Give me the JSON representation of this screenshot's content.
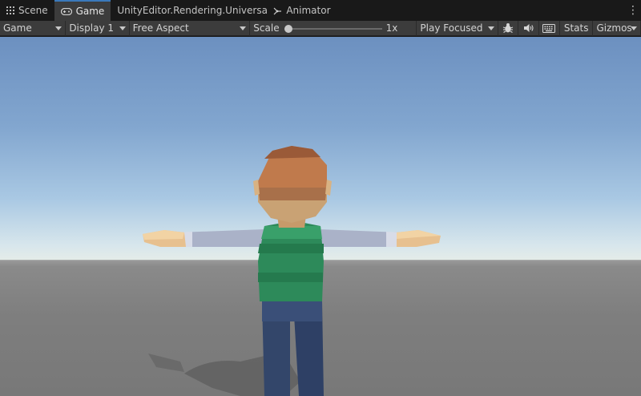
{
  "tabs": [
    {
      "label": "Scene",
      "icon": "grid-icon",
      "active": false
    },
    {
      "label": "Game",
      "icon": "gamepad-icon",
      "active": true
    },
    {
      "label": "UnityEditor.Rendering.Universal.Re",
      "icon": "",
      "active": false
    },
    {
      "label": "Animator",
      "icon": "animator-icon",
      "active": false
    }
  ],
  "tab_menu_icon": "kebab-menu-icon",
  "toolbar": {
    "game_dropdown": "Game",
    "display_dropdown": "Display 1",
    "aspect_dropdown": "Free Aspect",
    "scale_label": "Scale",
    "scale_value": "1x",
    "scale_level": 0,
    "play_mode_dropdown": "Play Focused",
    "stats_label": "Stats",
    "gizmos_label": "Gizmos",
    "icons": [
      "bug-icon",
      "audio-icon",
      "keyboard-icon"
    ]
  },
  "colors": {
    "active_tab_accent": "#3a79bb",
    "sky_top": "#6c90c0",
    "horizon": "#e4ece9",
    "ground": "#7e7e7e"
  }
}
